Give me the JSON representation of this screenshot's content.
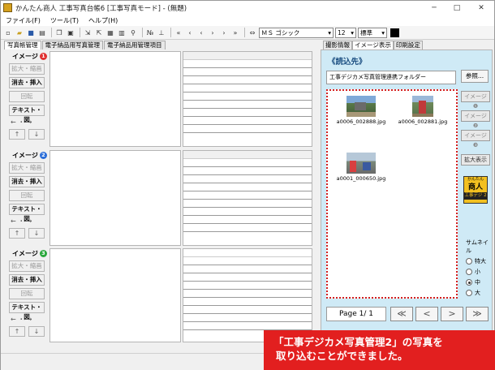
{
  "window": {
    "title": "かんたん商人 工事写真台帳6 [工事写真モード] - (無題)",
    "minimize": "─",
    "maximize": "□",
    "close": "✕"
  },
  "menu": [
    "ファイル(F)",
    "ツール(T)",
    "ヘルプ(H)"
  ],
  "toolbar": {
    "font_name": "ＭＳ ゴシック",
    "font_size": "12",
    "font_style": "標準",
    "text_color": "#000000"
  },
  "left_tabs": [
    "写真帳管理",
    "電子納品用写真管理",
    "電子納品用管理項目"
  ],
  "right_tabs": [
    "撮影情報",
    "イメージ表示",
    "印刷設定"
  ],
  "slots": [
    {
      "label": "イメージ",
      "num": "1",
      "num_color": "#e03030"
    },
    {
      "label": "イメージ",
      "num": "2",
      "num_color": "#2a6dd8"
    },
    {
      "label": "イメージ",
      "num": "3",
      "num_color": "#2aa83c"
    }
  ],
  "slot_buttons": {
    "zoom": "拡大・縮画",
    "delete_insert": "消去・挿入",
    "rotate": "回転",
    "text_figure": "テキスト・図",
    "arrows_label": "← ・ →",
    "up": "↑",
    "down": "↓"
  },
  "right_panel": {
    "title": "《読込先》",
    "folder_path": "工事デジカメ写真管理連携フォルダー",
    "browse_button": "参照...",
    "thumbnails": [
      {
        "caption": "a0006_002888.jpg"
      },
      {
        "caption": "a0006_002881.jpg"
      },
      {
        "caption": "a0001_000650.jpg"
      }
    ],
    "image_buttons": [
      "イメージ❶",
      "イメージ❷",
      "イメージ❸"
    ],
    "enlarge_button": "拡大表示",
    "badge_line1": "かんたん",
    "badge_line2": "商人",
    "badge_line3": "工事デジ 2",
    "thumb_size_label": "サムネイル",
    "thumb_sizes": [
      "特大",
      "大",
      "中",
      "小"
    ],
    "thumb_size_selected": "中",
    "pager": "Page 1/ 1",
    "nav": [
      "≪",
      "<",
      ">",
      "≫"
    ]
  },
  "caption": {
    "line1": "「工事デジカメ写真管理2」の写真を",
    "line2": "取り込むことができました。"
  }
}
